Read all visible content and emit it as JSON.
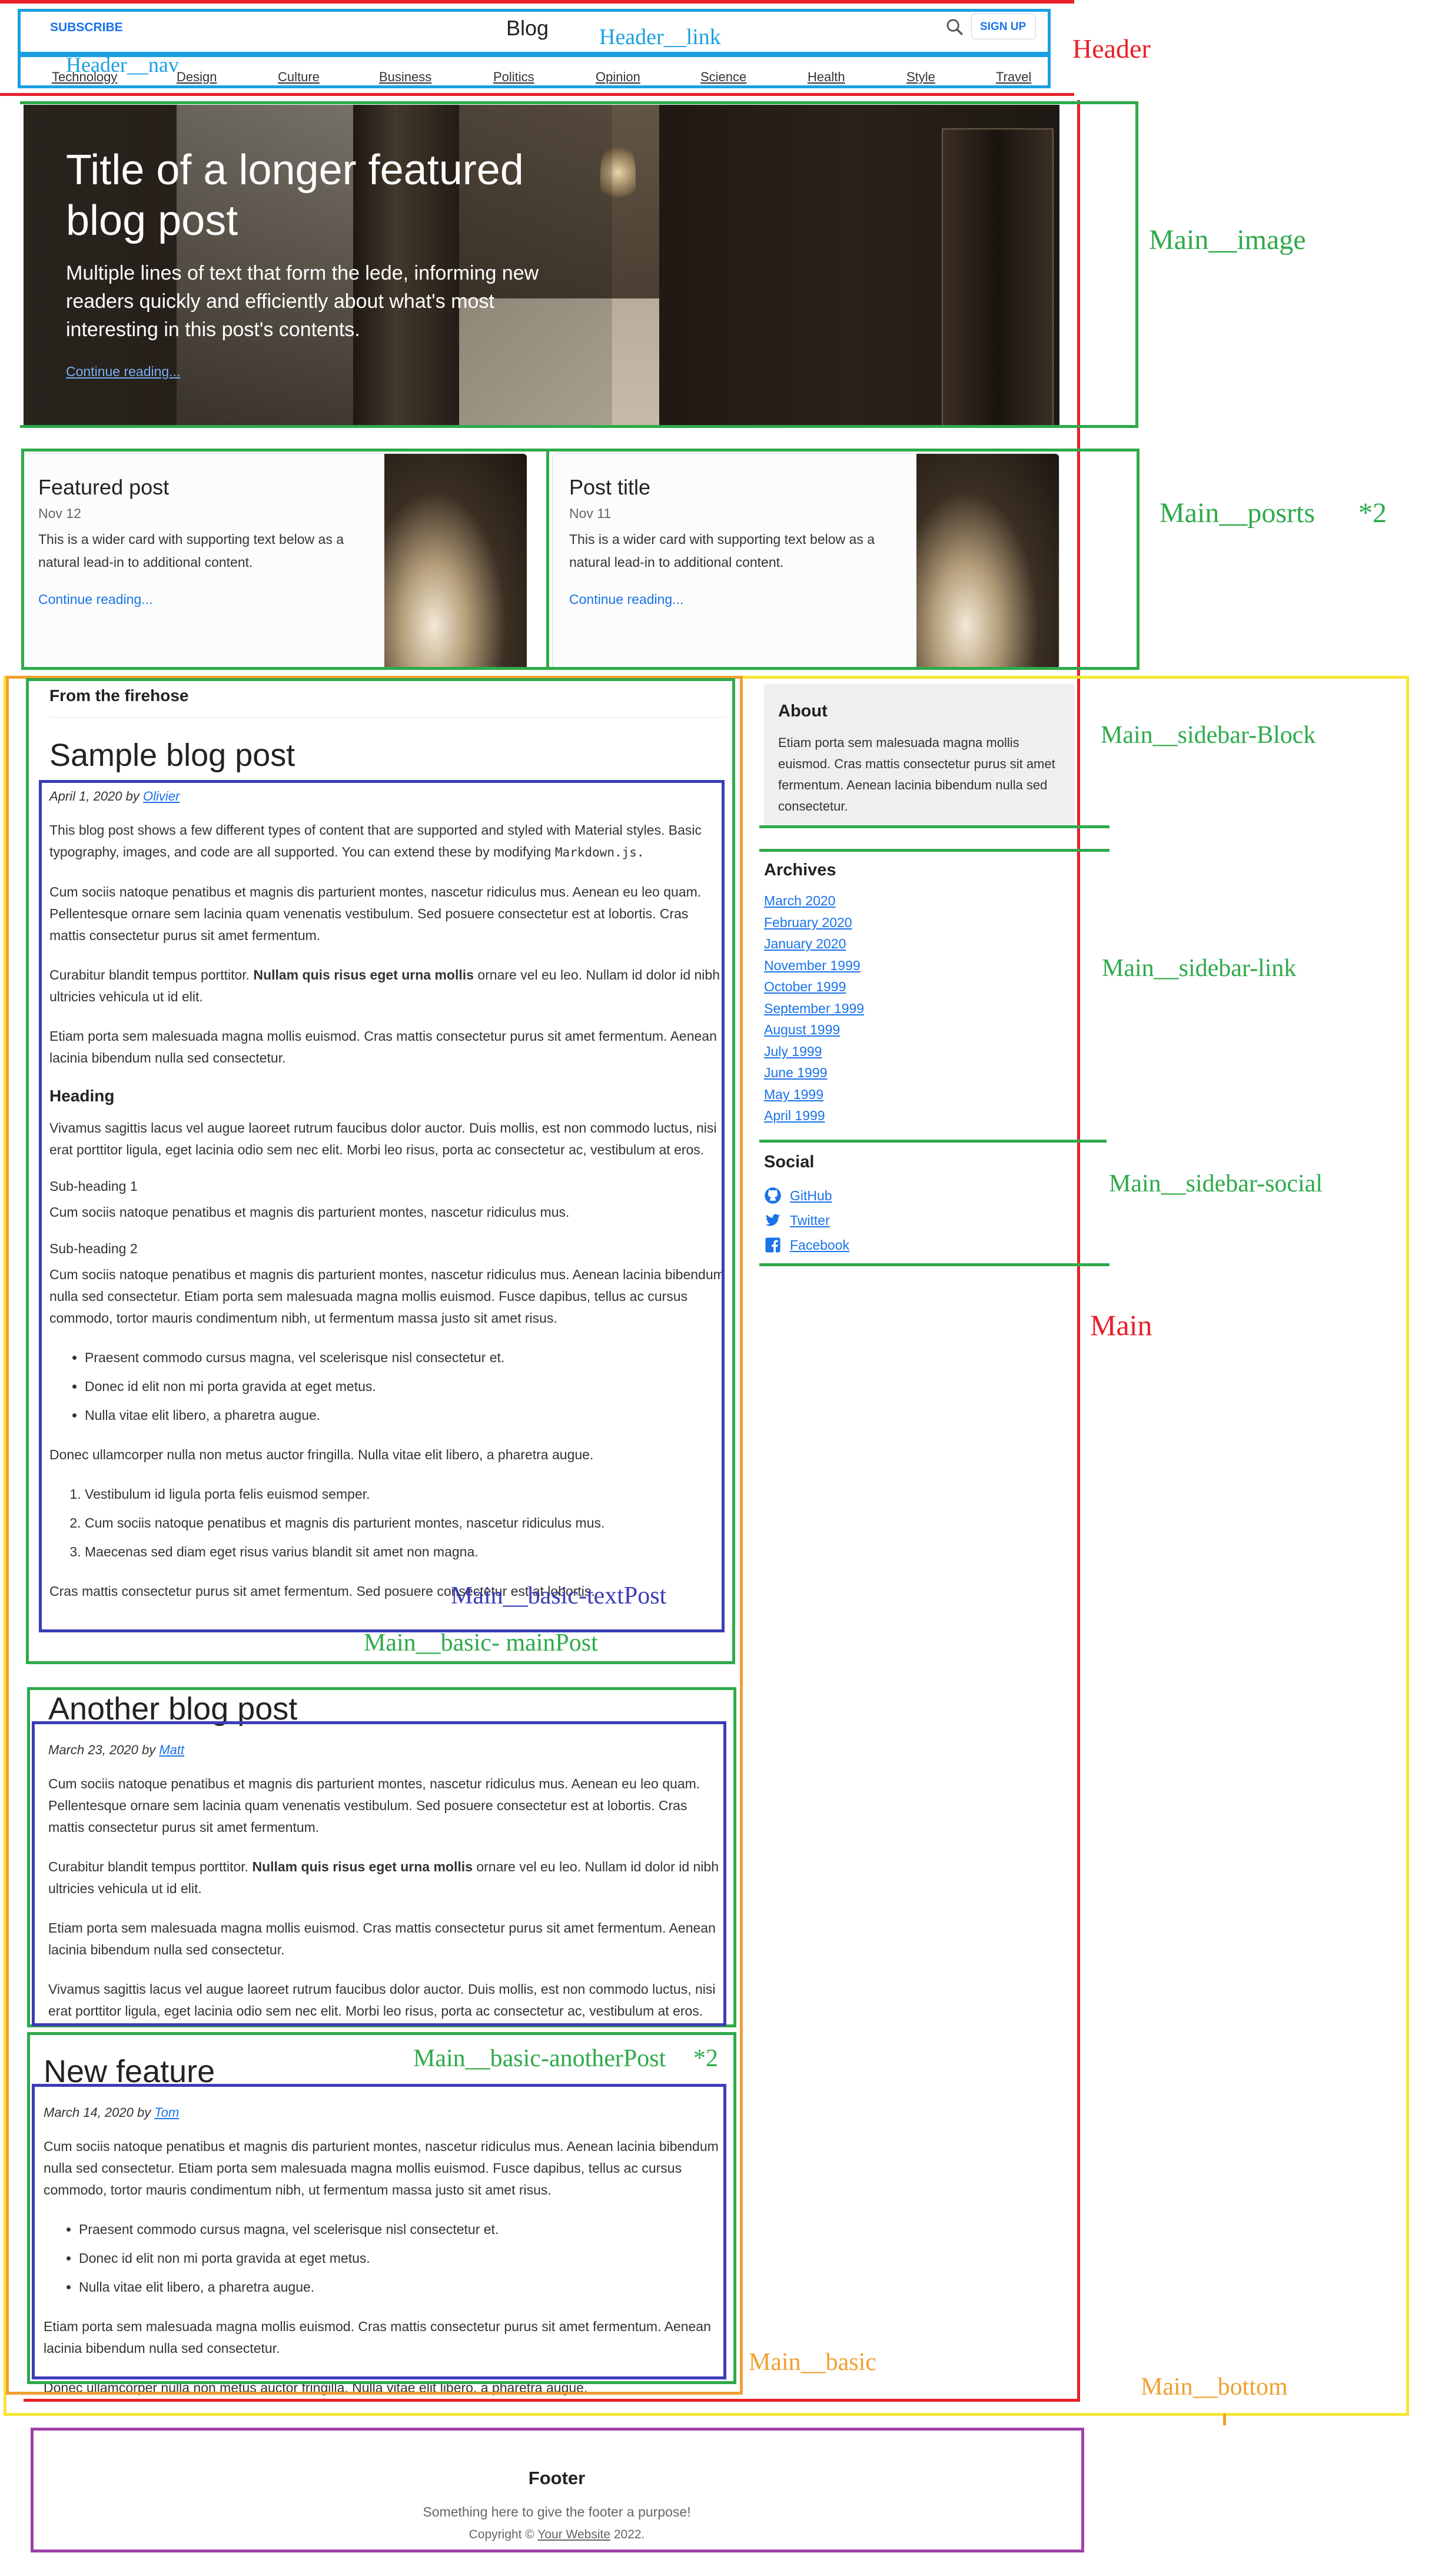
{
  "header": {
    "subscribe_label": "SUBSCRIBE",
    "title": "Blog",
    "signup_label": "SIGN UP",
    "nav": [
      "Technology",
      "Design",
      "Culture",
      "Business",
      "Politics",
      "Opinion",
      "Science",
      "Health",
      "Style",
      "Travel"
    ]
  },
  "featured": {
    "title": "Title of a longer featured blog post",
    "lede": "Multiple lines of text that form the lede, informing new readers quickly and efficiently about what's most interesting in this post's contents.",
    "link": "Continue reading..."
  },
  "cards": [
    {
      "title": "Featured post",
      "date": "Nov 12",
      "text": "This is a wider card with supporting text below as a natural lead-in to additional content.",
      "link": "Continue reading..."
    },
    {
      "title": "Post title",
      "date": "Nov 11",
      "text": "This is a wider card with supporting text below as a natural lead-in to additional content.",
      "link": "Continue reading..."
    }
  ],
  "main": {
    "section_title": "From the firehose",
    "post1": {
      "title": "Sample blog post",
      "date": "April 1, 2020 by",
      "author": "Olivier",
      "p1": "This blog post shows a few different types of content that are supported and styled with Material styles. Basic typography, images, and code are all supported. You can extend these by modifying",
      "code": "Markdown.js.",
      "p2": "Cum sociis natoque penatibus et magnis dis parturient montes, nascetur ridiculus mus. Aenean eu leo quam. Pellentesque ornare sem lacinia quam venenatis vestibulum. Sed posuere consectetur est at lobortis. Cras mattis consectetur purus sit amet fermentum.",
      "p3_start": "Curabitur blandit tempus porttitor.",
      "p3_bold": "Nullam quis risus eget urna mollis",
      "p3_end": "ornare vel eu leo. Nullam id dolor id nibh ultricies vehicula ut id elit.",
      "p4": "Etiam porta sem malesuada magna mollis euismod. Cras mattis consectetur purus sit amet fermentum. Aenean lacinia bibendum nulla sed consectetur.",
      "heading": "Heading",
      "p5": "Vivamus sagittis lacus vel augue laoreet rutrum faucibus dolor auctor. Duis mollis, est non commodo luctus, nisi erat porttitor ligula, eget lacinia odio sem nec elit. Morbi leo risus, porta ac consectetur ac, vestibulum at eros.",
      "sub1": "Sub-heading 1",
      "p6": "Cum sociis natoque penatibus et magnis dis parturient montes, nascetur ridiculus mus.",
      "sub2": "Sub-heading 2",
      "p7": "Cum sociis natoque penatibus et magnis dis parturient montes, nascetur ridiculus mus. Aenean lacinia bibendum nulla sed consectetur. Etiam porta sem malesuada magna mollis euismod. Fusce dapibus, tellus ac cursus commodo, tortor mauris condimentum nibh, ut fermentum massa justo sit amet risus.",
      "ul": [
        "Praesent commodo cursus magna, vel scelerisque nisl consectetur et.",
        "Donec id elit non mi porta gravida at eget metus.",
        "Nulla vitae elit libero, a pharetra augue."
      ],
      "p8": "Donec ullamcorper nulla non metus auctor fringilla. Nulla vitae elit libero, a pharetra augue.",
      "ol": [
        "Vestibulum id ligula porta felis euismod semper.",
        "Cum sociis natoque penatibus et magnis dis parturient montes, nascetur ridiculus mus.",
        "Maecenas sed diam eget risus varius blandit sit amet non magna."
      ],
      "p9": "Cras mattis consectetur purus sit amet fermentum. Sed posuere consectetur est at lobortis."
    },
    "post2": {
      "title": "Another blog post",
      "date": "March 23, 2020 by",
      "author": "Matt",
      "p1": "Cum sociis natoque penatibus et magnis dis parturient montes, nascetur ridiculus mus. Aenean eu leo quam. Pellentesque ornare sem lacinia quam venenatis vestibulum. Sed posuere consectetur est at lobortis. Cras mattis consectetur purus sit amet fermentum.",
      "p2_start": "Curabitur blandit tempus porttitor.",
      "p2_bold": "Nullam quis risus eget urna mollis",
      "p2_end": "ornare vel eu leo. Nullam id dolor id nibh ultricies vehicula ut id elit.",
      "p3": "Etiam porta sem malesuada magna mollis euismod. Cras mattis consectetur purus sit amet fermentum. Aenean lacinia bibendum nulla sed consectetur.",
      "p4": "Vivamus sagittis lacus vel augue laoreet rutrum faucibus dolor auctor. Duis mollis, est non commodo luctus, nisi erat porttitor ligula, eget lacinia odio sem nec elit. Morbi leo risus, porta ac consectetur ac, vestibulum at eros."
    },
    "post3": {
      "title": "New feature",
      "date": "March 14, 2020 by",
      "author": "Tom",
      "p1": "Cum sociis natoque penatibus et magnis dis parturient montes, nascetur ridiculus mus. Aenean lacinia bibendum nulla sed consectetur. Etiam porta sem malesuada magna mollis euismod. Fusce dapibus, tellus ac cursus commodo, tortor mauris condimentum nibh, ut fermentum massa justo sit amet risus.",
      "ul": [
        "Praesent commodo cursus magna, vel scelerisque nisl consectetur et.",
        "Donec id elit non mi porta gravida at eget metus.",
        "Nulla vitae elit libero, a pharetra augue."
      ],
      "p2": "Etiam porta sem malesuada magna mollis euismod. Cras mattis consectetur purus sit amet fermentum. Aenean lacinia bibendum nulla sed consectetur.",
      "p3": "Donec ullamcorper nulla non metus auctor fringilla. Nulla vitae elit libero, a pharetra augue."
    }
  },
  "sidebar": {
    "about_title": "About",
    "about_text": "Etiam porta sem malesuada magna mollis euismod. Cras mattis consectetur purus sit amet fermentum. Aenean lacinia bibendum nulla sed consectetur.",
    "archives_title": "Archives",
    "archives": [
      "March 2020",
      "February 2020",
      "January 2020",
      "November 1999",
      "October 1999",
      "September 1999",
      "August 1999",
      "July 1999",
      "June 1999",
      "May 1999",
      "April 1999"
    ],
    "social_title": "Social",
    "social": [
      "GitHub",
      "Twitter",
      "Facebook"
    ]
  },
  "footer": {
    "title": "Footer",
    "text": "Something here to give the footer a purpose!",
    "copyright_pre": "Copyright ©",
    "copyright_link": "Your Website",
    "copyright_post": "2022."
  },
  "annotations": {
    "header": "Header",
    "header_link": "Header__link",
    "header_nav": "Header__nav",
    "main_image": "Main__image",
    "main_posts": "Main__posrts",
    "main_posts_mult": "*2",
    "sidebar_block": "Main__sidebar-Block",
    "sidebar_link": "Main__sidebar-link",
    "sidebar_social": "Main__sidebar-social",
    "main": "Main",
    "text_post": "Main__basic-textPost",
    "main_post": "Main__basic- mainPost",
    "another_post": "Main__basic-anotherPost",
    "another_post_mult": "*2",
    "main_basic": "Main__basic",
    "main_bottom": "Main__bottom"
  },
  "colors": {
    "red": "#e8202a",
    "blue": "#1ba0e2",
    "green": "#2eaa4a",
    "navy": "#3c3cb8",
    "orange": "#f0a030",
    "yellow": "#f5e635",
    "purple": "#a040a8"
  }
}
